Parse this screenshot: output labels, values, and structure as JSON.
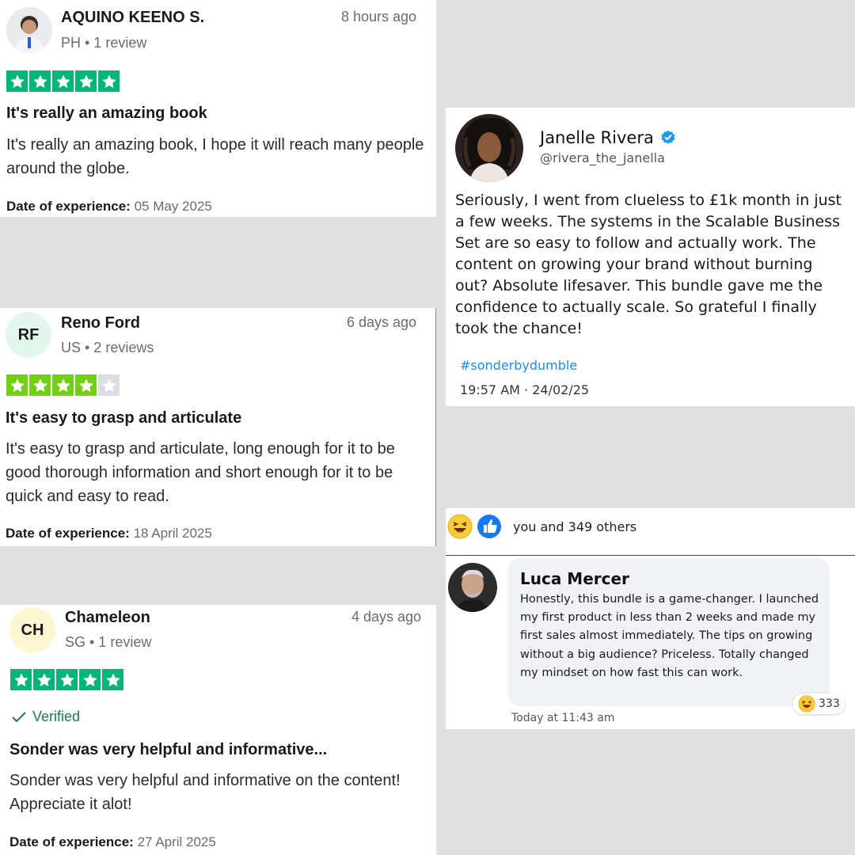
{
  "colors": {
    "star_green": "#00b67a",
    "star_light_green": "#73cf11",
    "star_empty": "#dcdce6",
    "verified_blue": "#1d9bf0",
    "hashtag_blue": "#1d8ee0",
    "verified_text": "#1a7a4a"
  },
  "reviews": [
    {
      "name": "AQUINO KEENO S.",
      "meta": "PH • 1 review",
      "time": "8 hours ago",
      "rating": 5,
      "title": "It's really an amazing book",
      "body": "It's really an amazing book, I hope it will reach many people around the globe.",
      "date_label": "Date of experience:",
      "date_value": "05 May 2025"
    },
    {
      "initials": "RF",
      "name": "Reno Ford",
      "meta": "US • 2 reviews",
      "time": "6 days ago",
      "rating": 4,
      "title": "It's easy to grasp and articulate",
      "body": "It's easy to grasp and articulate, long enough for it to be good thorough information and short enough for it to be quick and easy to read.",
      "date_label": "Date of experience:",
      "date_value": "18 April 2025"
    },
    {
      "initials": "CH",
      "name": "Chameleon",
      "meta": "SG • 1 review",
      "time": "4 days ago",
      "rating": 5,
      "verified": "Verified",
      "title": "Sonder was very helpful and informative...",
      "body": "Sonder was very helpful and informative on the content! Appreciate it alot!",
      "date_label": "Date of experience:",
      "date_value": "27 April 2025"
    }
  ],
  "tweet": {
    "name": "Janelle Rivera",
    "handle": "@rivera_the_janella",
    "body": "Seriously, I went from clueless to £1k month in just a few weeks. The systems in the Scalable Business Set are so easy to follow and actually work. The content on growing your brand without burning out? Absolute lifesaver. This bundle gave me the confidence to actually scale. So grateful I finally took the chance!",
    "hashtag": "#sonderbydumble",
    "time": "19:57 AM · 24/02/25"
  },
  "comment": {
    "reactions_text": "you and 349 others",
    "name": "Luca Mercer",
    "body": "Honestly, this bundle is a game-changer. I launched my first product in less than 2 weeks and made my first sales almost immediately. The tips on growing without a big audience? Priceless. Totally changed my mindset on how fast this can work.",
    "reaction_count": "333",
    "time": "Today at 11:43 am"
  }
}
